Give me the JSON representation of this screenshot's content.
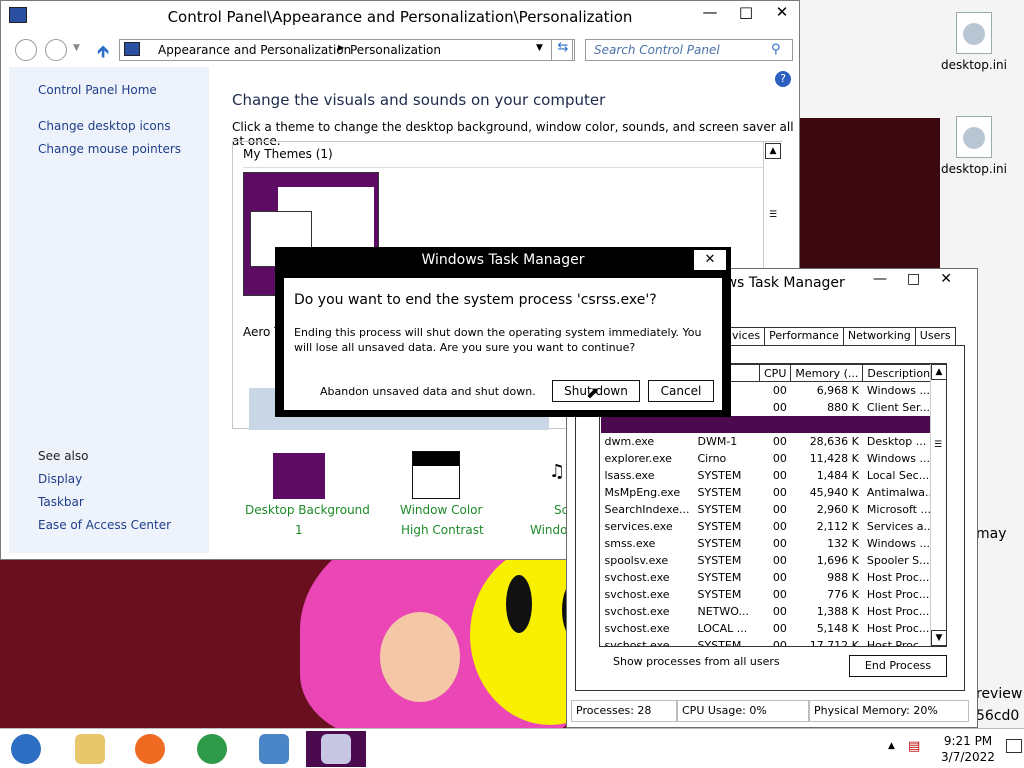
{
  "desktop": {
    "icons": [
      {
        "label": "desktop.ini"
      },
      {
        "label": "desktop.ini"
      }
    ],
    "fragments": [
      "may",
      "review",
      "56cd0"
    ]
  },
  "control_panel": {
    "title": "Control Panel\\Appearance and Personalization\\Personalization",
    "breadcrumb": [
      "Appearance and Personalization",
      "Personalization"
    ],
    "search_placeholder": "Search Control Panel",
    "sidebar": {
      "home": "Control Panel Home",
      "links": [
        "Change desktop icons",
        "Change mouse pointers"
      ],
      "see_also_title": "See also",
      "see_also": [
        "Display",
        "Taskbar",
        "Ease of Access Center"
      ]
    },
    "heading": "Change the visuals and sounds on your computer",
    "subheading": "Click a theme to change the desktop background, window color, sounds, and screen saver all at once.",
    "my_themes": "My Themes (1)",
    "aero_fragment": "Aero T",
    "options": [
      {
        "label": "Desktop Background",
        "value": "1"
      },
      {
        "label": "Window Color",
        "value": "High Contrast"
      },
      {
        "label": "Sc",
        "value": "Windo"
      }
    ]
  },
  "task_manager": {
    "title_fragment": "ows Task Manager",
    "tabs": [
      "vices",
      "Performance",
      "Networking",
      "Users"
    ],
    "columns": [
      "me",
      "CPU",
      "Memory (...",
      "Description"
    ],
    "rows": [
      {
        "name": "",
        "user": "",
        "cpu": "00",
        "mem": "6,968 K",
        "desc": "Windows ..."
      },
      {
        "name": "",
        "user": "",
        "cpu": "00",
        "mem": "880 K",
        "desc": "Client Ser..."
      },
      {
        "name": "",
        "user": "",
        "cpu": "",
        "mem": "",
        "desc": "",
        "selected": true
      },
      {
        "name": "dwm.exe",
        "user": "DWM-1",
        "cpu": "00",
        "mem": "28,636 K",
        "desc": "Desktop ..."
      },
      {
        "name": "explorer.exe",
        "user": "Cirno",
        "cpu": "00",
        "mem": "11,428 K",
        "desc": "Windows ..."
      },
      {
        "name": "lsass.exe",
        "user": "SYSTEM",
        "cpu": "00",
        "mem": "1,484 K",
        "desc": "Local Sec..."
      },
      {
        "name": "MsMpEng.exe",
        "user": "SYSTEM",
        "cpu": "00",
        "mem": "45,940 K",
        "desc": "Antimalwa..."
      },
      {
        "name": "SearchIndexe...",
        "user": "SYSTEM",
        "cpu": "00",
        "mem": "2,960 K",
        "desc": "Microsoft ..."
      },
      {
        "name": "services.exe",
        "user": "SYSTEM",
        "cpu": "00",
        "mem": "2,112 K",
        "desc": "Services a..."
      },
      {
        "name": "smss.exe",
        "user": "SYSTEM",
        "cpu": "00",
        "mem": "132 K",
        "desc": "Windows ..."
      },
      {
        "name": "spoolsv.exe",
        "user": "SYSTEM",
        "cpu": "00",
        "mem": "1,696 K",
        "desc": "Spooler S..."
      },
      {
        "name": "svchost.exe",
        "user": "SYSTEM",
        "cpu": "00",
        "mem": "988 K",
        "desc": "Host Proc..."
      },
      {
        "name": "svchost.exe",
        "user": "SYSTEM",
        "cpu": "00",
        "mem": "776 K",
        "desc": "Host Proc..."
      },
      {
        "name": "svchost.exe",
        "user": "NETWO...",
        "cpu": "00",
        "mem": "1,388 K",
        "desc": "Host Proc..."
      },
      {
        "name": "svchost.exe",
        "user": "LOCAL ...",
        "cpu": "00",
        "mem": "5,148 K",
        "desc": "Host Proc..."
      },
      {
        "name": "svchost.exe",
        "user": "SYSTEM",
        "cpu": "00",
        "mem": "17,712 K",
        "desc": "Host Proc..."
      }
    ],
    "show_all": "Show processes from all users",
    "end_process": "End Process",
    "status": [
      "Processes: 28",
      "CPU Usage: 0%",
      "Physical Memory: 20%"
    ]
  },
  "dialog": {
    "title": "Windows Task Manager",
    "question": "Do you want to end the system process 'csrss.exe'?",
    "message": "Ending this process will shut down the operating system immediately.  You will lose all unsaved data.  Are you sure you want to continue?",
    "abandon": "Abandon unsaved data and shut down.",
    "shutdown": "Shut down",
    "cancel": "Cancel"
  },
  "taskbar": {
    "time": "9:21 PM",
    "date": "3/7/2022"
  }
}
